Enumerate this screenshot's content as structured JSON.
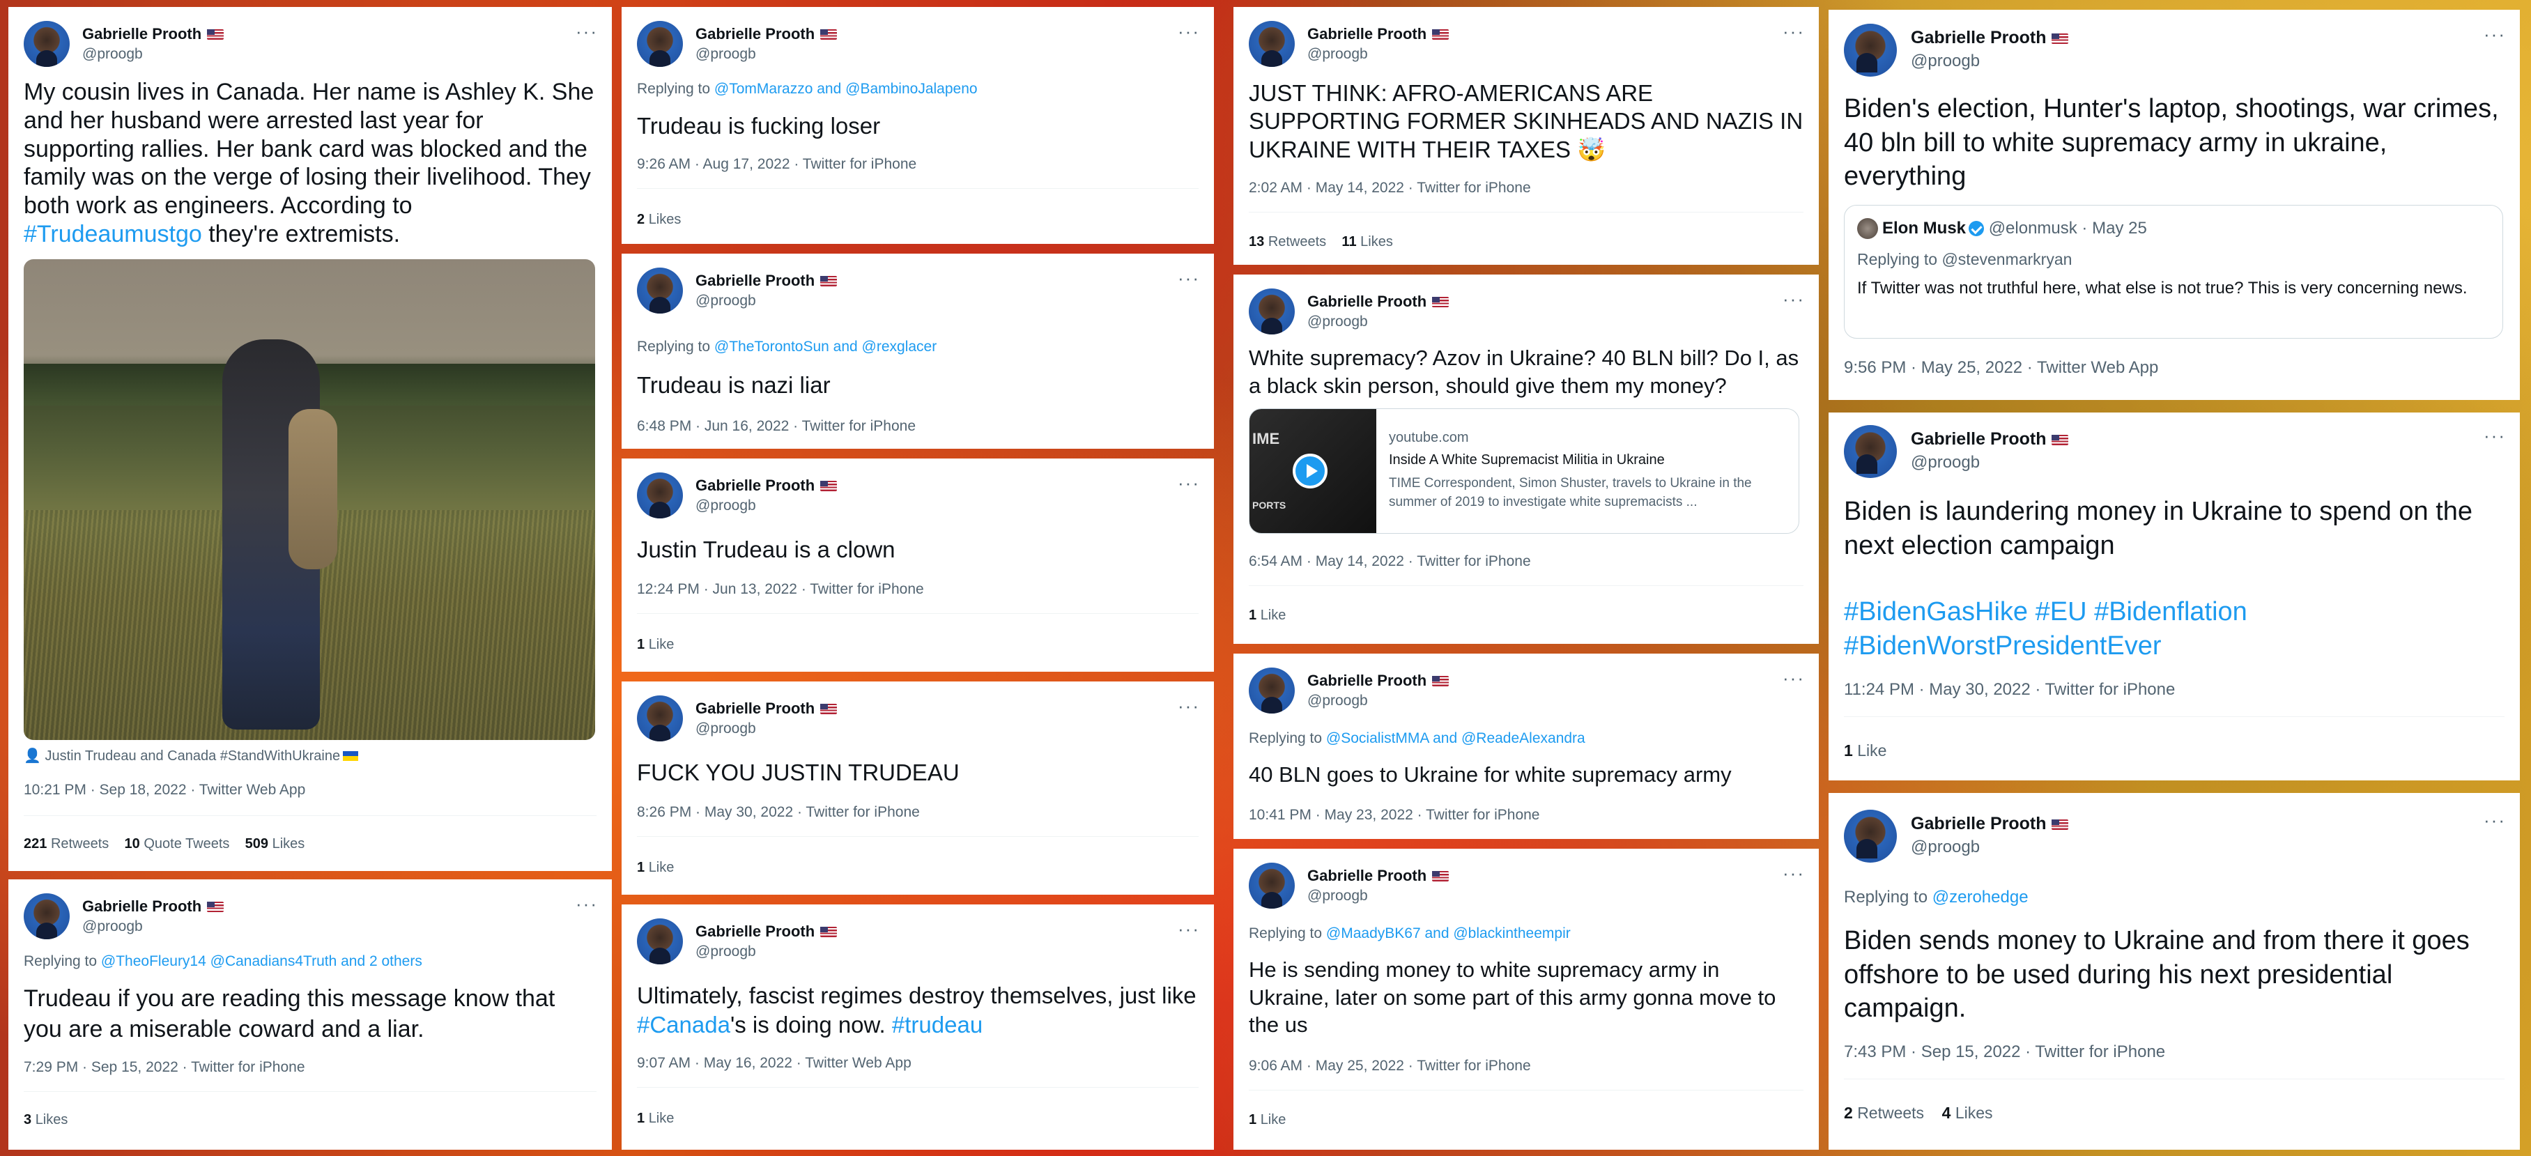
{
  "author": {
    "name": "Gabrielle Prooth",
    "handle": "@proogb"
  },
  "menu_icon": "more-dots-icon",
  "colors": {
    "link": "#1d9bf0",
    "secondary": "#536471",
    "text": "#0f1419"
  },
  "t1": {
    "text_a": "My cousin lives in Canada. Her name is Ashley K. She and her husband were arrested last year for supporting rallies. Her bank card was blocked and the family was on the verge of losing their livelihood. They both work as engineers. According to ",
    "tag": "#Trudeaumustgo",
    "text_b": " they're extremists.",
    "caption": "Justin Trudeau and Canada #StandWithUkraine",
    "meta": "10:21 PM · Sep 18, 2022 · Twitter Web App",
    "retweets": "221",
    "retweets_label": "Retweets",
    "quotes": "10",
    "quotes_label": "Quote Tweets",
    "likes": "509",
    "likes_label": "Likes"
  },
  "t2": {
    "reply_prefix": "Replying to ",
    "reply_to": "@TheoFleury14 @Canadians4Truth and 2 others",
    "text": "Trudeau if you are reading this message know that you are a miserable coward and a liar.",
    "meta": "7:29 PM · Sep 15, 2022 · Twitter for iPhone",
    "likes": "3",
    "likes_label": "Likes"
  },
  "t3": {
    "reply_prefix": "Replying to ",
    "reply_to": "@TomMarazzo and @BambinoJalapeno",
    "text": "Trudeau is fucking loser",
    "meta": "9:26 AM · Aug 17, 2022 · Twitter for iPhone",
    "likes": "2",
    "likes_label": "Likes"
  },
  "t4": {
    "reply_prefix": "Replying to ",
    "reply_to": "@TheTorontoSun and @rexglacer",
    "text": "Trudeau is nazi liar",
    "meta": "6:48 PM · Jun 16, 2022 · Twitter for iPhone"
  },
  "t5": {
    "text": "Justin Trudeau is a clown",
    "meta": "12:24 PM · Jun 13, 2022 · Twitter for iPhone",
    "likes": "1",
    "likes_label": "Like"
  },
  "t6": {
    "text": "FUCK YOU JUSTIN TRUDEAU",
    "meta": "8:26 PM · May 30, 2022 · Twitter for iPhone",
    "likes": "1",
    "likes_label": "Like"
  },
  "t7": {
    "text_a": "Ultimately, fascist regimes destroy themselves, just like ",
    "tag1": "#Canada",
    "text_b": "'s is doing now. ",
    "tag2": "#trudeau",
    "meta": "9:07 AM · May 16, 2022 · Twitter Web App",
    "likes": "1",
    "likes_label": "Like"
  },
  "t8": {
    "text": "JUST THINK: AFRO-AMERICANS ARE SUPPORTING FORMER SKINHEADS AND NAZIS IN UKRAINE WITH THEIR TAXES 🤯",
    "meta": "2:02 AM · May 14, 2022 · Twitter for iPhone",
    "retweets": "13",
    "retweets_label": "Retweets",
    "likes": "11",
    "likes_label": "Likes"
  },
  "t9": {
    "text": "White supremacy? Azov in Ukraine? 40 BLN bill? Do I, as a black skin person, should give them my money?",
    "link_domain": "youtube.com",
    "link_title": "Inside A White Supremacist Militia in Ukraine",
    "link_desc": "TIME Correspondent, Simon Shuster, travels to Ukraine in the summer of 2019 to investigate white supremacists ...",
    "thumb_top": "IME",
    "thumb_bottom": "PORTS",
    "meta": "6:54 AM · May 14, 2022 · Twitter for iPhone",
    "likes": "1",
    "likes_label": "Like"
  },
  "t10": {
    "reply_prefix": "Replying to ",
    "reply_to": "@SocialistMMA and @ReadeAlexandra",
    "text": "40 BLN goes to Ukraine for white supremacy army",
    "meta": "10:41 PM · May 23, 2022 · Twitter for iPhone"
  },
  "t11": {
    "reply_prefix": "Replying to ",
    "reply_to": "@MaadyBK67 and @blackintheempir",
    "text": "He is sending money to white supremacy army in Ukraine, later on some part of this army gonna move to the us",
    "meta": "9:06 AM · May 25, 2022 · Twitter for iPhone",
    "likes": "1",
    "likes_label": "Like"
  },
  "t12": {
    "text": "Biden's election, Hunter's laptop, shootings, war crimes, 40 bln bill to white supremacy army in ukraine, everything",
    "quote_name": "Elon Musk",
    "quote_handle": "@elonmusk · May 25",
    "quote_reply": "Replying to @stevenmarkryan",
    "quote_text": "If Twitter was not truthful here, what else is not true? This is very concerning news.",
    "meta": "9:56 PM · May 25, 2022 · Twitter Web App"
  },
  "t13": {
    "text": "Biden is laundering money in Ukraine to spend on the next election campaign",
    "tags": "#BidenGasHike #EU #Bidenflation",
    "tags2": "#BidenWorstPresidentEver",
    "meta": "11:24 PM · May 30, 2022 · Twitter for iPhone",
    "likes": "1",
    "likes_label": "Like"
  },
  "t14": {
    "reply_prefix": "Replying to ",
    "reply_to": "@zerohedge",
    "text": "Biden sends money to Ukraine and from there it goes offshore to be used during his next presidential campaign.",
    "meta": "7:43 PM · Sep 15, 2022 · Twitter for iPhone",
    "retweets": "2",
    "retweets_label": "Retweets",
    "likes": "4",
    "likes_label": "Likes"
  }
}
